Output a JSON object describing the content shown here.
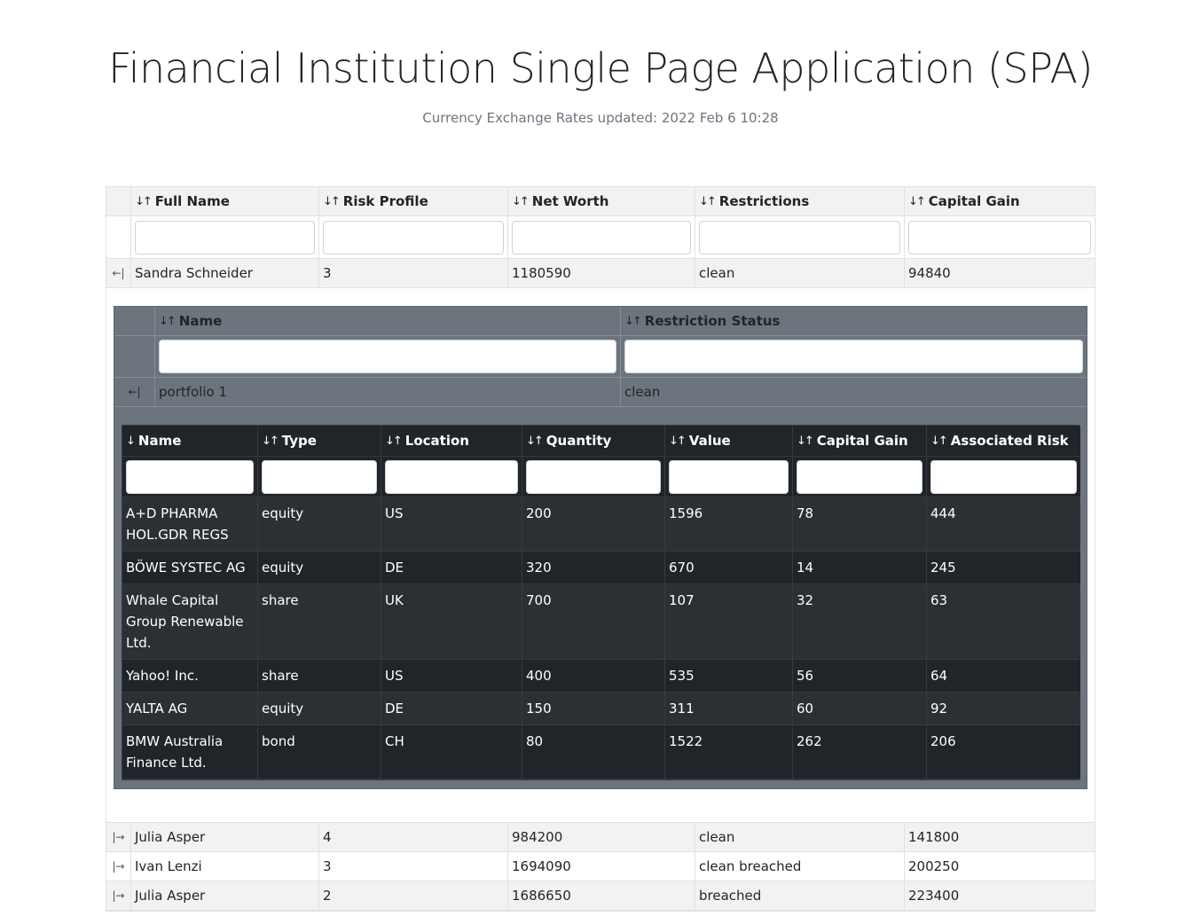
{
  "page": {
    "title": "Financial Institution Single Page Application (SPA)",
    "subtitle": "Currency Exchange Rates updated: 2022 Feb 6 10:28"
  },
  "icons": {
    "sort_both": "sort-both-icon",
    "sort_down": "sort-down-icon",
    "collapse": "collapse-icon",
    "expand": "expand-icon"
  },
  "glyphs": {
    "sort_both": "↓↑",
    "sort_down": "↓",
    "collapse": "←|",
    "expand": "|→"
  },
  "clients": {
    "columns": [
      "Full Name",
      "Risk Profile",
      "Net Worth",
      "Restrictions",
      "Capital Gain"
    ],
    "expanded_row": {
      "full_name": "Sandra Schneider",
      "risk_profile": "3",
      "net_worth": "1180590",
      "restrictions": "clean",
      "capital_gain": "94840"
    },
    "rows": [
      {
        "full_name": "Julia Asper",
        "risk_profile": "4",
        "net_worth": "984200",
        "restrictions": "clean",
        "capital_gain": "141800"
      },
      {
        "full_name": "Ivan Lenzi",
        "risk_profile": "3",
        "net_worth": "1694090",
        "restrictions": "clean breached",
        "capital_gain": "200250"
      },
      {
        "full_name": "Julia Asper",
        "risk_profile": "2",
        "net_worth": "1686650",
        "restrictions": "breached",
        "capital_gain": "223400"
      }
    ]
  },
  "portfolios": {
    "columns": [
      "Name",
      "Restriction Status"
    ],
    "expanded_row": {
      "name": "portfolio 1",
      "restriction_status": "clean"
    }
  },
  "positions": {
    "columns": [
      "Name",
      "Type",
      "Location",
      "Quantity",
      "Value",
      "Capital Gain",
      "Associated Risk"
    ],
    "rows": [
      {
        "name": "A+D PHARMA HOL.GDR REGS",
        "type": "equity",
        "location": "US",
        "quantity": "200",
        "value": "1596",
        "capital_gain": "78",
        "associated_risk": "444"
      },
      {
        "name": "BÖWE SYSTEC AG",
        "type": "equity",
        "location": "DE",
        "quantity": "320",
        "value": "670",
        "capital_gain": "14",
        "associated_risk": "245"
      },
      {
        "name": "Whale Capital Group Renewable Ltd.",
        "type": "share",
        "location": "UK",
        "quantity": "700",
        "value": "107",
        "capital_gain": "32",
        "associated_risk": "63"
      },
      {
        "name": "Yahoo! Inc.",
        "type": "share",
        "location": "US",
        "quantity": "400",
        "value": "535",
        "capital_gain": "56",
        "associated_risk": "64"
      },
      {
        "name": "YALTA AG",
        "type": "equity",
        "location": "DE",
        "quantity": "150",
        "value": "311",
        "capital_gain": "60",
        "associated_risk": "92"
      },
      {
        "name": "BMW Australia Finance Ltd.",
        "type": "bond",
        "location": "CH",
        "quantity": "80",
        "value": "1522",
        "capital_gain": "262",
        "associated_risk": "206"
      }
    ]
  }
}
